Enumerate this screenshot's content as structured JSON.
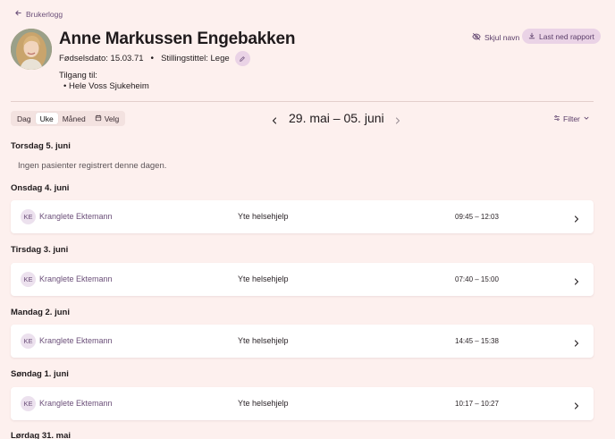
{
  "nav": {
    "back_label": "Brukerlogg"
  },
  "profile": {
    "name": "Anne Markussen Engebakken",
    "birth_label": "Fødselsdato: 15.03.71",
    "job_label": "Stillingstittel: Lege",
    "separator": "•",
    "access_label": "Tilgang til:",
    "access_items": [
      "• Hele Voss Sjukeheim"
    ]
  },
  "actions": {
    "hide_name_label": "Skjul navn",
    "download_label": "Last ned rapport"
  },
  "period": {
    "options": [
      "Dag",
      "Uke",
      "Måned",
      "Velg"
    ],
    "selected": "Uke",
    "range": "29. mai – 05. juni"
  },
  "filter_label": "Filter",
  "days": [
    {
      "title": "Torsdag 5. juni",
      "empty_text": "Ingen pasienter registrert denne dagen."
    },
    {
      "title": "Onsdag 4. juni",
      "entry": {
        "initials": "KE",
        "name": "Kranglete Ektemann",
        "task": "Yte helsehjelp",
        "time": "09:45 – 12:03"
      }
    },
    {
      "title": "Tirsdag 3. juni",
      "entry": {
        "initials": "KE",
        "name": "Kranglete Ektemann",
        "task": "Yte helsehjelp",
        "time": "07:40 – 15:00"
      }
    },
    {
      "title": "Mandag 2. juni",
      "entry": {
        "initials": "KE",
        "name": "Kranglete Ektemann",
        "task": "Yte helsehjelp",
        "time": "14:45 – 15:38"
      }
    },
    {
      "title": "Søndag 1. juni",
      "entry": {
        "initials": "KE",
        "name": "Kranglete Ektemann",
        "task": "Yte helsehjelp",
        "time": "10:17 – 10:27"
      }
    },
    {
      "title": "Lørdag 31. mai"
    }
  ],
  "colors": {
    "background": "#fdf0ee",
    "accent": "#6b4f79",
    "chip": "#ead3e6"
  }
}
